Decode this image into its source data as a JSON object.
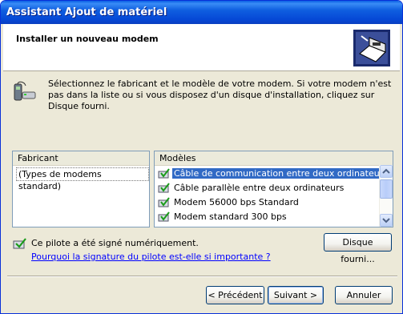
{
  "window": {
    "title": "Assistant Ajout de matériel"
  },
  "header": {
    "title": "Installer un nouveau modem",
    "icon": "hardware-wizard-icon"
  },
  "intro": {
    "icon": "modem-icon",
    "text": "Sélectionnez le fabricant et le modèle de votre modem. Si votre modem n'est pas dans la liste ou si vous disposez d'un disque d'installation, cliquez sur Disque fourni."
  },
  "manufacturers": {
    "header": "Fabricant",
    "items": [
      {
        "label": "(Types de modems standard)",
        "selected": true
      }
    ]
  },
  "models": {
    "header": "Modèles",
    "items": [
      {
        "label": "Câble de communication entre deux ordinateurs",
        "selected": true
      },
      {
        "label": "Câble parallèle entre deux ordinateurs",
        "selected": false
      },
      {
        "label": "Modem 56000 bps Standard",
        "selected": false
      },
      {
        "label": "Modem standard   300 bps",
        "selected": false
      }
    ]
  },
  "signature": {
    "icon": "signed-driver-icon",
    "text": "Ce pilote a été signé numériquement.",
    "link": "Pourquoi la signature du pilote est-elle si importante ?"
  },
  "buttons": {
    "have_disk": "Disque fourni...",
    "back": "< Précédent",
    "next": "Suivant >",
    "cancel": "Annuler"
  },
  "colors": {
    "titlebar": "#0a5fe4",
    "dialog": "#ece9d8",
    "selection": "#316ac5",
    "link": "#0000ff"
  }
}
